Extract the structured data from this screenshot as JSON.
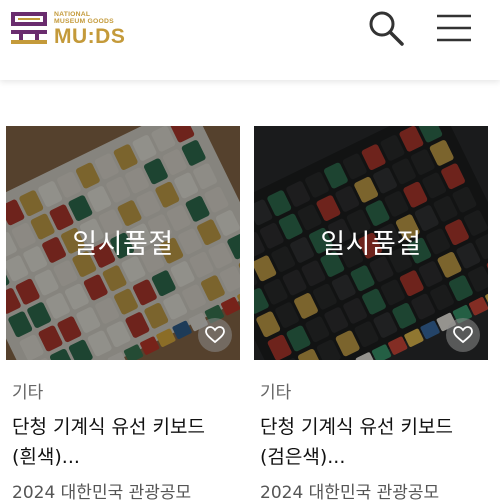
{
  "header": {
    "logo_small_line1": "NATIONAL",
    "logo_small_line2": "MUSEUM GOODS",
    "logo_big": "MU:DS",
    "brand_color": "#6a2c6e",
    "accent_color": "#c49a3a",
    "search_icon": "search-icon",
    "menu_icon": "hamburger-menu-icon"
  },
  "products": [
    {
      "status": "일시품절",
      "category": "기타",
      "name_line1": "단청 기계식 유선 키보드",
      "name_line2": "(흰색)...",
      "maker": "2024 대한민국 관광공모",
      "wish_icon": "heart-icon"
    },
    {
      "status": "일시품절",
      "category": "기타",
      "name_line1": "단청 기계식 유선 키보드",
      "name_line2": "(검은색)...",
      "maker": "2024 대한민국 관광공모",
      "wish_icon": "heart-icon"
    }
  ]
}
